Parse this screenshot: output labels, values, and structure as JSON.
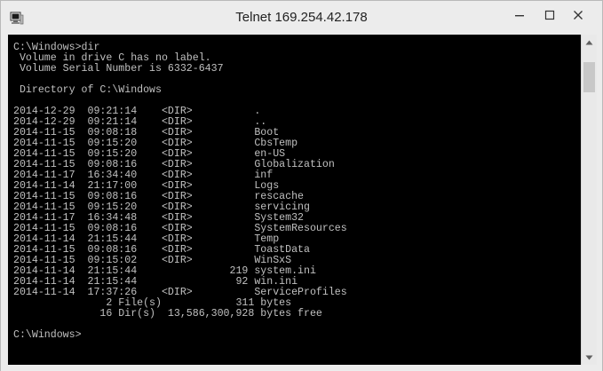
{
  "window": {
    "title": "Telnet 169.254.42.178"
  },
  "console": {
    "lines": [
      "C:\\Windows>dir",
      " Volume in drive C has no label.",
      " Volume Serial Number is 6332-6437",
      "",
      " Directory of C:\\Windows",
      "",
      "2014-12-29  09:21:14    <DIR>          .",
      "2014-12-29  09:21:14    <DIR>          ..",
      "2014-11-15  09:08:18    <DIR>          Boot",
      "2014-11-15  09:15:20    <DIR>          CbsTemp",
      "2014-11-15  09:15:20    <DIR>          en-US",
      "2014-11-15  09:08:16    <DIR>          Globalization",
      "2014-11-17  16:34:40    <DIR>          inf",
      "2014-11-14  21:17:00    <DIR>          Logs",
      "2014-11-15  09:08:16    <DIR>          rescache",
      "2014-11-15  09:15:20    <DIR>          servicing",
      "2014-11-17  16:34:48    <DIR>          System32",
      "2014-11-15  09:08:16    <DIR>          SystemResources",
      "2014-11-14  21:15:44    <DIR>          Temp",
      "2014-11-15  09:08:16    <DIR>          ToastData",
      "2014-11-15  09:15:02    <DIR>          WinSxS",
      "2014-11-14  21:15:44               219 system.ini",
      "2014-11-14  21:15:44                92 win.ini",
      "2014-11-14  17:37:26    <DIR>          ServiceProfiles",
      "               2 File(s)            311 bytes",
      "              16 Dir(s)  13,586,300,928 bytes free",
      "",
      "C:\\Windows>"
    ]
  },
  "scrollbar": {
    "position_fraction": 0.0
  }
}
